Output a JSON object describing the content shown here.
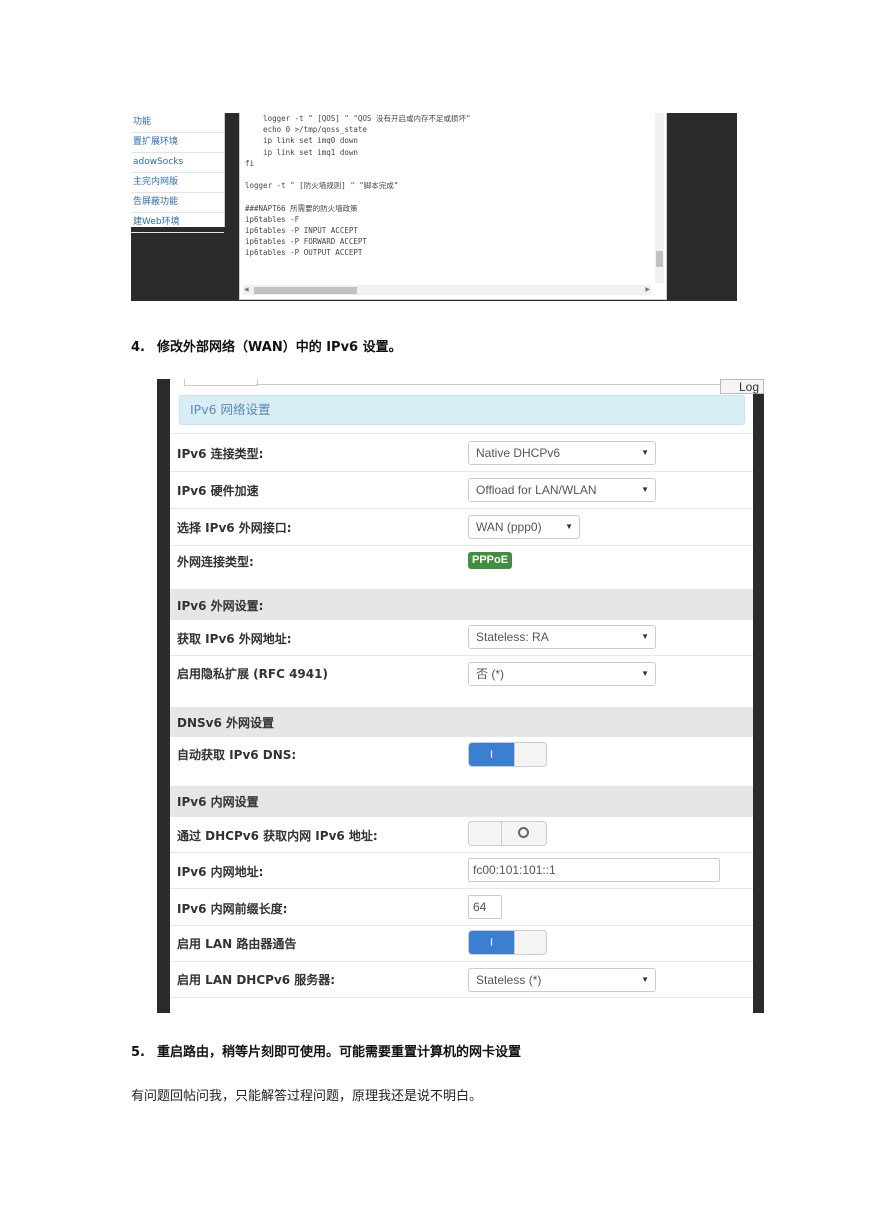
{
  "screenshot1": {
    "sidebar_items": [
      "功能",
      "置扩展环境",
      "adowSocks",
      "主完内网版",
      "告屏蔽功能",
      "建Web环境"
    ],
    "code_lines": [
      "    logger -t \" [QOS] \" \"QOS 没有开启或内存不足或损坏\"",
      "    echo 0 >/tmp/qoss_state",
      "    ip link set imq0 down",
      "    ip link set imq1 down",
      "fi",
      "",
      "logger -t \" [防火墙规则] \" \"脚本完成\"",
      "",
      "###NAPT66 所需要的防火墙政策",
      "ip6tables -F",
      "ip6tables -P INPUT ACCEPT",
      "ip6tables -P FORWARD ACCEPT",
      "ip6tables -P OUTPUT ACCEPT"
    ]
  },
  "step4": {
    "num": "4.",
    "text": "修改外部网络（WAN）中的 IPv6 设置。"
  },
  "screenshot2": {
    "log_button": "Log",
    "header": "IPv6 网络设置",
    "conn_type_label": "IPv6 连接类型:",
    "conn_type_value": "Native DHCPv6",
    "hw_accel_label": "IPv6 硬件加速",
    "hw_accel_value": "Offload for LAN/WLAN",
    "wan_iface_label": "选择 IPv6 外网接口:",
    "wan_iface_value": "WAN (ppp0)",
    "wan_type_label": "外网连接类型:",
    "wan_type_value": "PPPoE",
    "wan_section": "IPv6 外网设置:",
    "wan_addr_label": "获取 IPv6 外网地址:",
    "wan_addr_value": "Stateless: RA",
    "privacy_label": "启用隐私扩展 (RFC 4941)",
    "privacy_value": "否 (*)",
    "dns_section": "DNSv6 外网设置",
    "auto_dns_label": "自动获取 IPv6 DNS:",
    "auto_dns_on": true,
    "lan_section": "IPv6 内网设置",
    "dhcp_lan_label": "通过 DHCPv6 获取内网 IPv6 地址:",
    "dhcp_lan_on": false,
    "lan_addr_label": "IPv6 内网地址:",
    "lan_addr_value": "fc00:101:101::1",
    "prefix_label": "IPv6 内网前缀长度:",
    "prefix_value": "64",
    "ra_label": "启用 LAN 路由器通告",
    "ra_on": true,
    "dhcp_server_label": "启用 LAN DHCPv6 服务器:",
    "dhcp_server_value": "Stateless (*)",
    "toggle_on_glyph": "I",
    "dropdown_glyph": "▼"
  },
  "step5": {
    "num": "5.",
    "text": "重启路由，稍等片刻即可使用。可能需要重置计算机的网卡设置"
  },
  "footer_text": "有问题回帖问我，只能解答过程问题，原理我还是说不明白。"
}
